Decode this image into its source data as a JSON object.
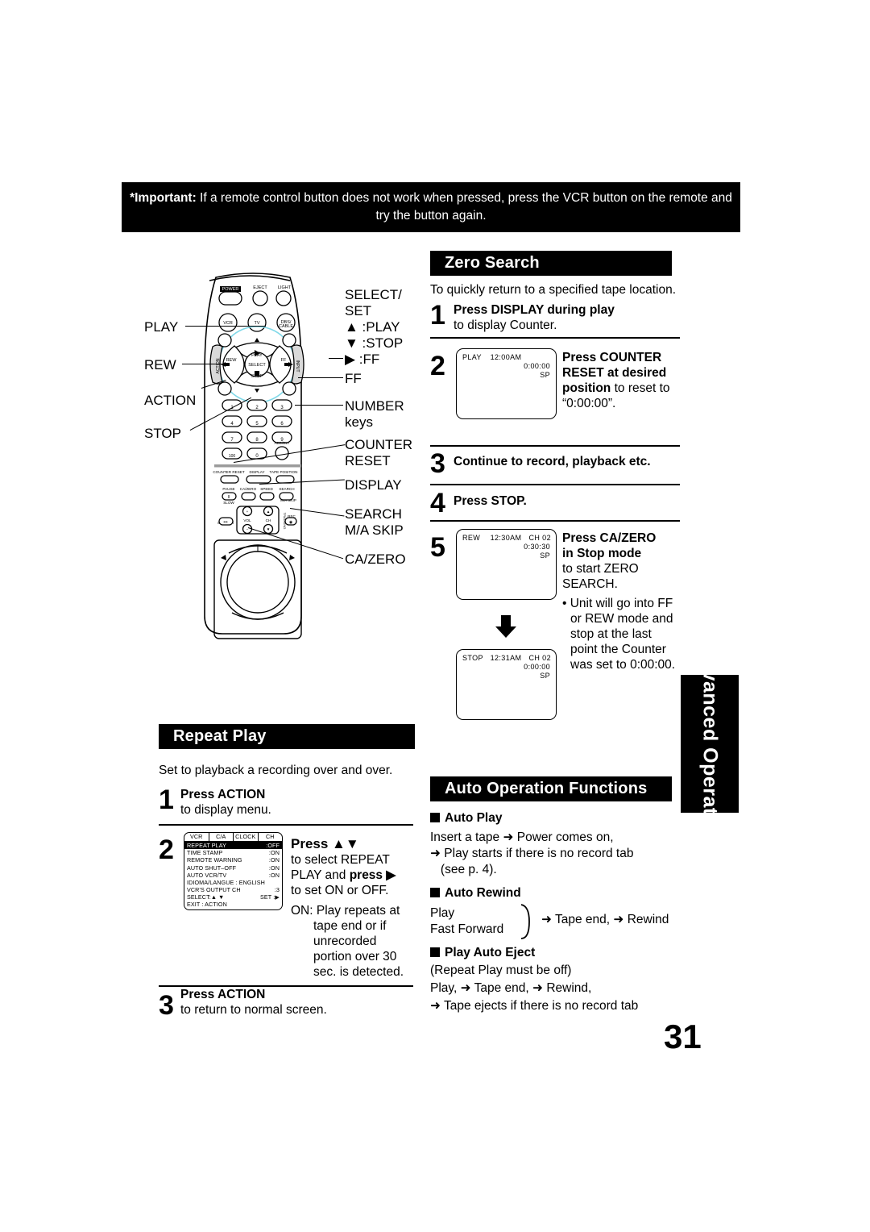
{
  "important": {
    "label": "*Important:",
    "text": " If a remote control button does not work when pressed, press the VCR button on the remote and try the button again."
  },
  "remote": {
    "left_labels": [
      {
        "name": "play",
        "text": "PLAY"
      },
      {
        "name": "rew",
        "text": "REW"
      },
      {
        "name": "action",
        "text": "ACTION"
      },
      {
        "name": "stop",
        "text": "STOP"
      }
    ],
    "right_labels": [
      {
        "name": "select-set",
        "text": "SELECT/"
      },
      {
        "name": "select-set-2",
        "text": "SET"
      },
      {
        "name": "select-up",
        "text": "▲ :PLAY"
      },
      {
        "name": "select-down",
        "text": "▼ :STOP"
      },
      {
        "name": "select-right",
        "text": "▶ :FF"
      },
      {
        "name": "ff",
        "text": "FF"
      },
      {
        "name": "number-keys",
        "text": "NUMBER"
      },
      {
        "name": "number-keys-2",
        "text": "keys"
      },
      {
        "name": "counter-reset",
        "text": "COUNTER"
      },
      {
        "name": "counter-reset-2",
        "text": "RESET"
      },
      {
        "name": "display",
        "text": "DISPLAY"
      },
      {
        "name": "search",
        "text": "SEARCH"
      },
      {
        "name": "ma-skip",
        "text": "M/A SKIP"
      },
      {
        "name": "ca-zero",
        "text": "CA/ZERO"
      }
    ],
    "buttons": {
      "power": "POWER",
      "eject": "EJECT",
      "light": "LIGHT",
      "vcr": "VCR",
      "tv": "TV",
      "dbb": "DBS/\nCABLE",
      "play": "PLAY",
      "rew": "REW",
      "ff": "FF",
      "stop": "STOP",
      "select": "SELECT",
      "action": "ACTION",
      "input": "INPUT",
      "numbers": [
        "1",
        "2",
        "3",
        "4",
        "5",
        "6",
        "7",
        "8",
        "9",
        "100",
        "0"
      ],
      "add_dlt": "ADD/DLT",
      "counter_reset": "COUNTER RESET",
      "display": "DISPLAY",
      "tape_position": "TAPE POSITION",
      "pause": "PAUSE",
      "ca_zero": "CA/ZERO",
      "speed": "SPEED",
      "search": "SEARCH",
      "slow": "SLOW",
      "ma_skip": "M/A SKIP",
      "sap": "SAP/Hi-Fi",
      "vol": "VOL",
      "ch": "CH",
      "rec": "REC",
      "tracking": "TRACKING"
    }
  },
  "zero_search": {
    "title": "Zero Search",
    "intro": "To quickly return to a specified tape location.",
    "steps": [
      {
        "num": "1",
        "bold": "Press DISPLAY during play",
        "rest": "to display Counter."
      },
      {
        "num": "2",
        "bold": "Press COUNTER",
        "bold2": "RESET at desired",
        "bold3": "position",
        "rest": " to reset to",
        "rest2": "“0:00:00”."
      },
      {
        "num": "3",
        "bold": "Continue to record, playback etc."
      },
      {
        "num": "4",
        "bold": "Press STOP."
      },
      {
        "num": "5",
        "bold": "Press CA/ZERO",
        "bold2": "in Stop mode",
        "rest": "to start ZERO",
        "rest2": "SEARCH.",
        "note": "• Unit will go into FF",
        "note2": "or REW mode and",
        "note3": "stop at the last",
        "note4": "point the Counter",
        "note5": "was set to 0:00:00."
      }
    ],
    "screen_step2": {
      "mode": "PLAY",
      "clock": "12:00AM",
      "ch": "",
      "counter": "0:00:00",
      "speed": "SP"
    },
    "screen_step5a": {
      "mode": "REW",
      "clock": "12:30AM",
      "ch": "CH 02",
      "counter": "0:30:30",
      "speed": "SP"
    },
    "screen_step5b": {
      "mode": "STOP",
      "clock": "12:31AM",
      "ch": "CH 02",
      "counter": "0:00:00",
      "speed": "SP"
    }
  },
  "repeat_play": {
    "title": "Repeat Play",
    "intro": "Set to playback a recording over and over.",
    "steps": [
      {
        "num": "1",
        "bold": "Press ACTION",
        "rest": "to display menu."
      },
      {
        "num": "2",
        "bold": "Press ▲▼",
        "rest": "to select REPEAT",
        "rest2a": "PLAY and ",
        "rest2b": "press ▶",
        "rest3": "to set ON or OFF.",
        "note": "ON: Play repeats at",
        "note2": "tape end or if",
        "note3": "unrecorded",
        "note4": "portion over 30",
        "note5": "sec. is detected."
      },
      {
        "num": "3",
        "bold": "Press ACTION",
        "rest": "to return to normal screen."
      }
    ],
    "osd_menu": {
      "tabs": [
        "VCR",
        "C/A",
        "CLOCK",
        "CH"
      ],
      "rows": [
        {
          "label": "REPEAT  PLAY",
          "value": ":OFF",
          "highlight": true
        },
        {
          "label": "TIME  STAMP",
          "value": ":ON",
          "highlight": false
        },
        {
          "label": "REMOTE WARNING",
          "value": ":ON",
          "highlight": false
        },
        {
          "label": "AUTO  SHUT–OFF",
          "value": ":ON",
          "highlight": false
        },
        {
          "label": "AUTO  VCR/TV",
          "value": ":ON",
          "highlight": false
        },
        {
          "label": "IDIOMA/LANGUE : ENGLISH",
          "value": "",
          "highlight": false
        },
        {
          "label": "VCR'S  OUTPUT CH",
          "value": ":3",
          "highlight": false
        }
      ],
      "footer": [
        {
          "label": "SELECT:▲ ▼",
          "value": "SET :▶"
        },
        {
          "label": "EXIT     : ACTION",
          "value": ""
        }
      ]
    }
  },
  "auto_operation": {
    "title": "Auto Operation Functions",
    "sections": [
      {
        "heading": "Auto Play",
        "lines": [
          "Insert a tape ➜ Power comes on,",
          "➜ Play starts if there is no record tab",
          "   (see p. 4)."
        ]
      },
      {
        "heading": "Auto Rewind",
        "left1": "Play",
        "left2": "Fast Forward",
        "right": "➜ Tape end, ➜ Rewind"
      },
      {
        "heading": "Play Auto Eject",
        "lines": [
          "(Repeat Play must be off)",
          "Play, ➜ Tape end, ➜ Rewind,",
          "➜ Tape ejects if there is no record tab"
        ]
      }
    ]
  },
  "side_tab": "Advanced Operation",
  "page_number": "31"
}
